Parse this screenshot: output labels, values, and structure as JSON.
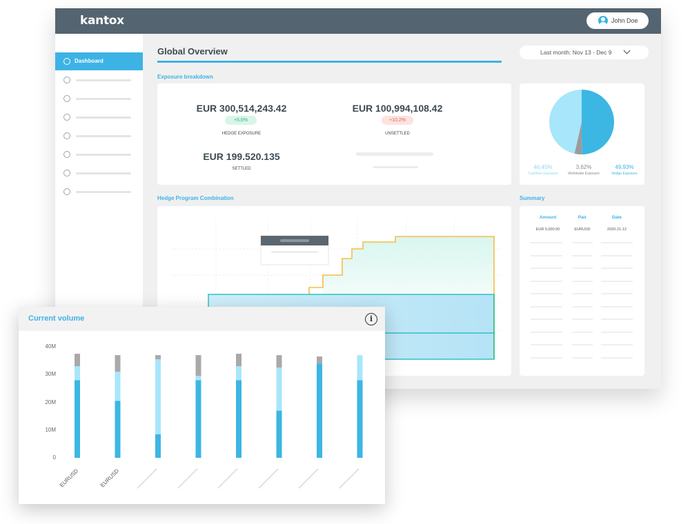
{
  "app": {
    "logo": "kantox",
    "user_name": "John Doe"
  },
  "sidebar": {
    "items": [
      {
        "label": "Dashboard",
        "icon": "dashboard-icon",
        "active": true
      },
      {
        "label": "",
        "icon": "globe-icon"
      },
      {
        "label": "",
        "icon": "clock-icon"
      },
      {
        "label": "",
        "icon": "exchange-icon"
      },
      {
        "label": "",
        "icon": "document-icon"
      },
      {
        "label": "",
        "icon": "send-icon"
      },
      {
        "label": "",
        "icon": "help-icon"
      },
      {
        "label": "",
        "icon": "settings-icon"
      }
    ]
  },
  "header": {
    "title": "Global Overview",
    "date_range": "Last month: Nov 13 - Dec 9"
  },
  "exposure": {
    "section_label": "Exposure breakdown",
    "hedge_amount": "EUR 300,514,243.42",
    "hedge_badge": "+5,6%",
    "hedge_caption": "HEDGE EXPOSURE",
    "unsettled_amount": "EUR 100,994,108.42",
    "unsettled_badge": "+10,2%",
    "unsettled_caption": "UNSETTLED",
    "settled_amount": "EUR 199.520.135",
    "settled_caption": "SETTLED"
  },
  "pie": {
    "slices": [
      {
        "name": "Hedge Exposure",
        "value": 49.93,
        "color": "#3cb6e3"
      },
      {
        "name": "Worldwide Exposure",
        "value": 3.62,
        "color": "#9b9b9b"
      },
      {
        "name": "Cashflow Exposure",
        "value": 46.45,
        "color": "#a8e6fb"
      }
    ],
    "legend": [
      {
        "value": "46,45%",
        "label": "Cashflow Exposure",
        "color": "#8fd8f3"
      },
      {
        "value": "3,62%",
        "label": "Worldwide Exposure",
        "color": "#8a8a8a"
      },
      {
        "value": "49,93%",
        "label": "Hedge Exposure",
        "color": "#3db3e5"
      }
    ]
  },
  "hedge_program": {
    "section_label": "Hedge Program Combination"
  },
  "summary": {
    "section_label": "Summary",
    "columns": [
      "Amount",
      "Pair",
      "Date"
    ],
    "row": [
      "EUR 5,000.00",
      "EURUSD",
      "2020-21-12"
    ]
  },
  "chart_data": {
    "type": "bar",
    "title": "Current volume",
    "categories": [
      "EURUSD",
      "EURUSD",
      "",
      "",
      "",
      "",
      "",
      ""
    ],
    "ylim": [
      0,
      40000000
    ],
    "yticks": [
      "0",
      "10M",
      "20M",
      "30M",
      "40M"
    ],
    "series": [
      {
        "values": [
          28000000,
          20500000,
          8500000,
          28000000,
          28000000,
          17000000,
          34000000,
          28000000
        ],
        "color": "#3cb6e3"
      },
      {
        "values": [
          5000000,
          10500000,
          27000000,
          1500000,
          5000000,
          15500000,
          0,
          9000000
        ],
        "color": "#a8e6fb"
      },
      {
        "values": [
          4500000,
          6000000,
          1500000,
          7500000,
          4500000,
          4500000,
          2500000,
          0
        ],
        "color": "#a9a9a9"
      }
    ]
  }
}
